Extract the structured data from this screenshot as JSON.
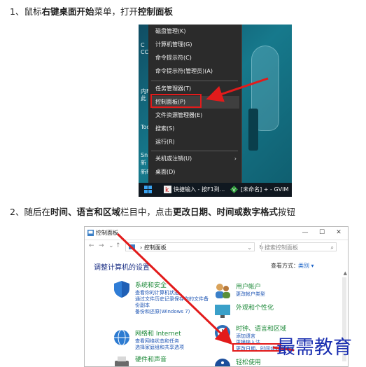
{
  "step1": {
    "num": "1、",
    "seg": [
      "鼠标",
      "右键桌面开始",
      "菜单，打开",
      "控制面板"
    ]
  },
  "step2": {
    "num": "2、",
    "seg": [
      "随后在",
      "时间、语言和区域",
      "栏目中，点击",
      "更改日期、时间或数字格式",
      "按钮"
    ]
  },
  "context_menu": {
    "items": [
      "磁盘管理(K)",
      "计算机管理(G)",
      "命令提示符(C)",
      "命令提示符(管理员)(A)",
      "任务管理器(T)",
      "控制面板(P)",
      "文件资源管理器(E)",
      "搜索(S)",
      "运行(R)",
      "关机或注销(U)",
      "桌面(D)"
    ],
    "desktop_labels": [
      "C",
      "CC",
      "内F",
      "此",
      "Toc",
      "Sn",
      "新",
      "新F"
    ]
  },
  "taskbar": {
    "task1": "快捷输入 - 按F1到...",
    "task2": "[未命名] + - GVIM"
  },
  "control_panel": {
    "title": "控制面板",
    "address": "控制面板",
    "search_placeholder": "搜索控制面板",
    "heading": "调整计算机的设置",
    "view_by_label": "查看方式：",
    "view_by_value": "类别 ▾",
    "categories": [
      {
        "title": "系统和安全",
        "links": [
          "查看你的计算机状态",
          "通过文件历史记录保存你的文件备",
          "份副本",
          "备份和还原(Windows 7)"
        ],
        "color": "#1f5fb5"
      },
      {
        "title": "网络和 Internet",
        "links": [
          "查看网络状态和任务",
          "选择家庭组和共享选项"
        ],
        "color": "#2d7bd1"
      },
      {
        "title": "硬件和声音",
        "links": [],
        "color": "#6a6a6a"
      },
      {
        "title": "用户帐户",
        "links": [
          "更改帐户类型"
        ],
        "color": "#3a7fc8"
      },
      {
        "title": "外观和个性化",
        "links": [],
        "color": "#3aa0c9"
      },
      {
        "title": "时钟、语言和区域",
        "links": [
          "添加语言",
          "更换输入法",
          "更改日期、时间或数字格式"
        ],
        "color": "#2c6fb8"
      },
      {
        "title": "轻松使用",
        "links": [],
        "color": "#1b4e9b"
      }
    ]
  },
  "watermark": "最需教育",
  "colors": {
    "highlight_red": "#e21b1b",
    "link_blue": "#1e55b4",
    "category_green": "#1e8a3a"
  }
}
